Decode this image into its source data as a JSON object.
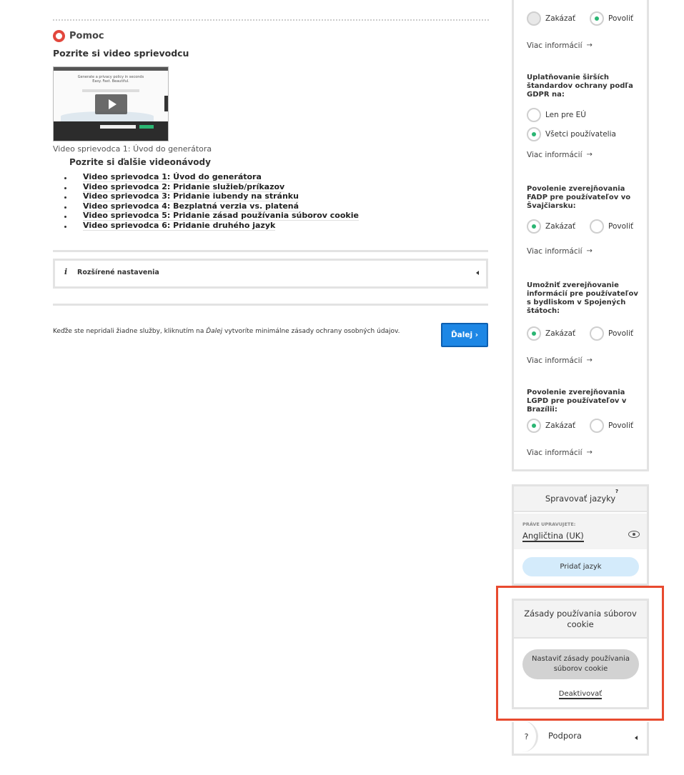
{
  "help": {
    "title": "Pomoc",
    "watch_title": "Pozrite si video sprievodcu",
    "video_thumb": {
      "headline": "Generate a privacy policy in seconds",
      "subline": "Easy. Fast. Beautiful."
    },
    "video_caption": "Video sprievodca 1: Úvod do generátora",
    "more_videos_title": "Pozrite si ďalšie videonávody",
    "videos": [
      "Video sprievodca 1: Úvod do generátora",
      "Video sprievodca 2: Pridanie služieb/príkazov",
      "Video sprievodca 3: Pridanie iubendy na stránku",
      "Video sprievodca 4: Bezplatná verzia vs. platená",
      "Video sprievodca 5: Pridanie zásad používania súborov cookie",
      "Video sprievodca 6: Pridanie druhého jazyk"
    ]
  },
  "advanced": {
    "label": "Rozšírené nastavenia"
  },
  "footer": {
    "note_before": "Keďže ste nepridali žiadne služby, kliknutím na ",
    "note_em": "Ďalej",
    "note_after": " vytvoríte minimálne zásady ochrany osobných údajov.",
    "next_label": "Ďalej ›"
  },
  "gdpr": {
    "top_deny": "Zakázať",
    "top_allow": "Povoliť",
    "more_info": "Viac informácií",
    "arrow": "→",
    "standards_question": "Uplatňovanie širších štandardov ochrany podľa GDPR na:",
    "eu_only": "Len pre EÚ",
    "all_users": "Všetci používatelia",
    "fadp_question": "Povolenie zverejňovania FADP pre používateľov vo Švajčiarsku:",
    "us_question": "Umožniť zverejňovanie informácií pre používateľov s bydliskom v Spojených štátoch:",
    "lgpd_question": "Povolenie zverejňovania LGPD pre používateľov v Brazílii:",
    "deny": "Zakázať",
    "allow": "Povoliť",
    "states": {
      "top": "allow",
      "standards": "all_users",
      "fadp": "deny",
      "us": "deny",
      "lgpd": "deny"
    }
  },
  "languages": {
    "title": "Spravovať jazyky",
    "help": "?",
    "editing_caption": "PRÁVE UPRAVUJETE:",
    "current": "Angličtina (UK)",
    "add_label": "Pridať jazyk"
  },
  "cookie": {
    "title": "Zásady používania súborov cookie",
    "setup_label": "Nastaviť zásady používania súborov cookie",
    "deactivate_label": "Deaktivovať"
  },
  "support": {
    "icon": "?",
    "label": "Podpora"
  },
  "colors": {
    "accent_blue": "#1d87e5",
    "radio_green": "#2bb673",
    "highlight_red": "#e84a2f",
    "add_lang_bg": "#d4ebfb"
  }
}
